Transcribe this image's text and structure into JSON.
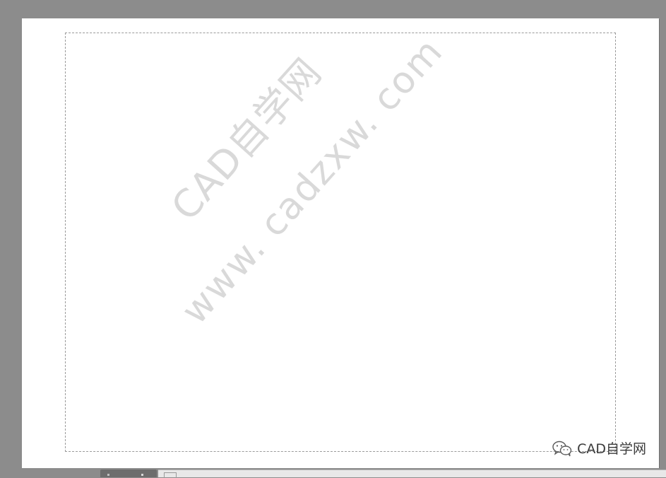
{
  "watermark": {
    "line1": "CAD自学网",
    "line2": "www. cadzxw. com"
  },
  "brand": {
    "icon": "wechat-icon",
    "text": "CAD自学网"
  },
  "layout_tabs": {
    "active_tab_label": ""
  },
  "colors": {
    "workspace": "#8c8c8c",
    "paper": "#ffffff",
    "printable_border": "#9a9a9a",
    "watermark": "#d2d2d2"
  }
}
